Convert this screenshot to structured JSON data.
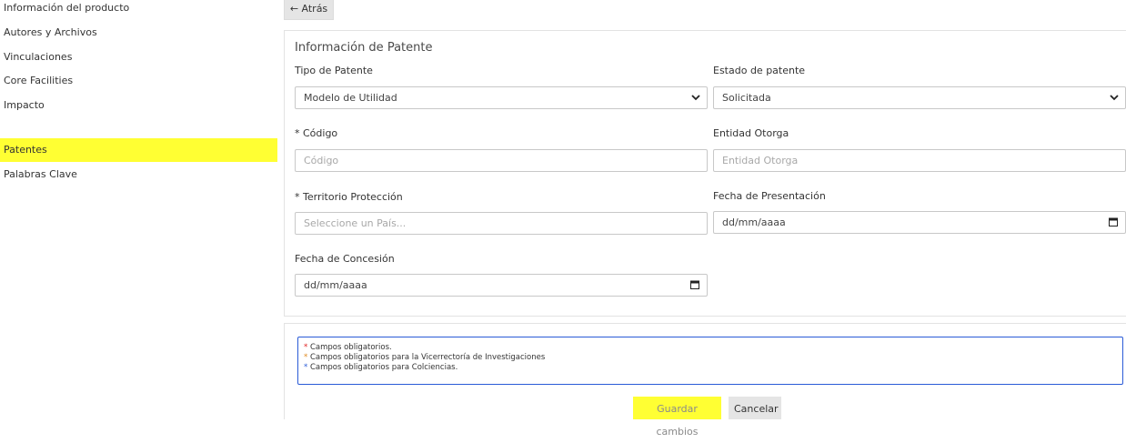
{
  "sidebar": {
    "items": [
      {
        "label": "Información del producto"
      },
      {
        "label": "Autores y Archivos"
      },
      {
        "label": "Vinculaciones"
      },
      {
        "label": "Core Facilities"
      },
      {
        "label": "Impacto"
      },
      {
        "label": "Patentes",
        "active": true
      },
      {
        "label": "Palabras Clave"
      }
    ]
  },
  "back_button": {
    "label": "← Atrás"
  },
  "form": {
    "title": "Información de Patente",
    "tipo_patente": {
      "label": "Tipo de Patente",
      "value": "Modelo de Utilidad"
    },
    "estado_patente": {
      "label": "Estado de patente",
      "value": "Solicitada"
    },
    "codigo": {
      "label": "* Código",
      "placeholder": "Código"
    },
    "entidad_otorga": {
      "label": "Entidad Otorga",
      "placeholder": "Entidad Otorga"
    },
    "territorio": {
      "label": "* Territorio Protección",
      "placeholder": "Seleccione un País..."
    },
    "fecha_presentacion": {
      "label": "Fecha de Presentación",
      "value": "dd/mm/aaaa"
    },
    "fecha_concesion": {
      "label": "Fecha de Concesión",
      "value": "dd/mm/aaaa"
    }
  },
  "legend": {
    "star": "*",
    "items": [
      {
        "text": "Campos obligatorios.",
        "color": "#e02020"
      },
      {
        "text": "Campos obligatorios para la Vicerrectoría de Investigaciones",
        "color": "#e08a20"
      },
      {
        "text": "Campos obligatorios para Colciencias.",
        "color": "#2a5bd7"
      }
    ]
  },
  "buttons": {
    "save": "Guardar cambios",
    "cancel": "Cancelar"
  },
  "colors": {
    "highlight": "#ffff33",
    "legend_border": "#2a5bd7"
  }
}
